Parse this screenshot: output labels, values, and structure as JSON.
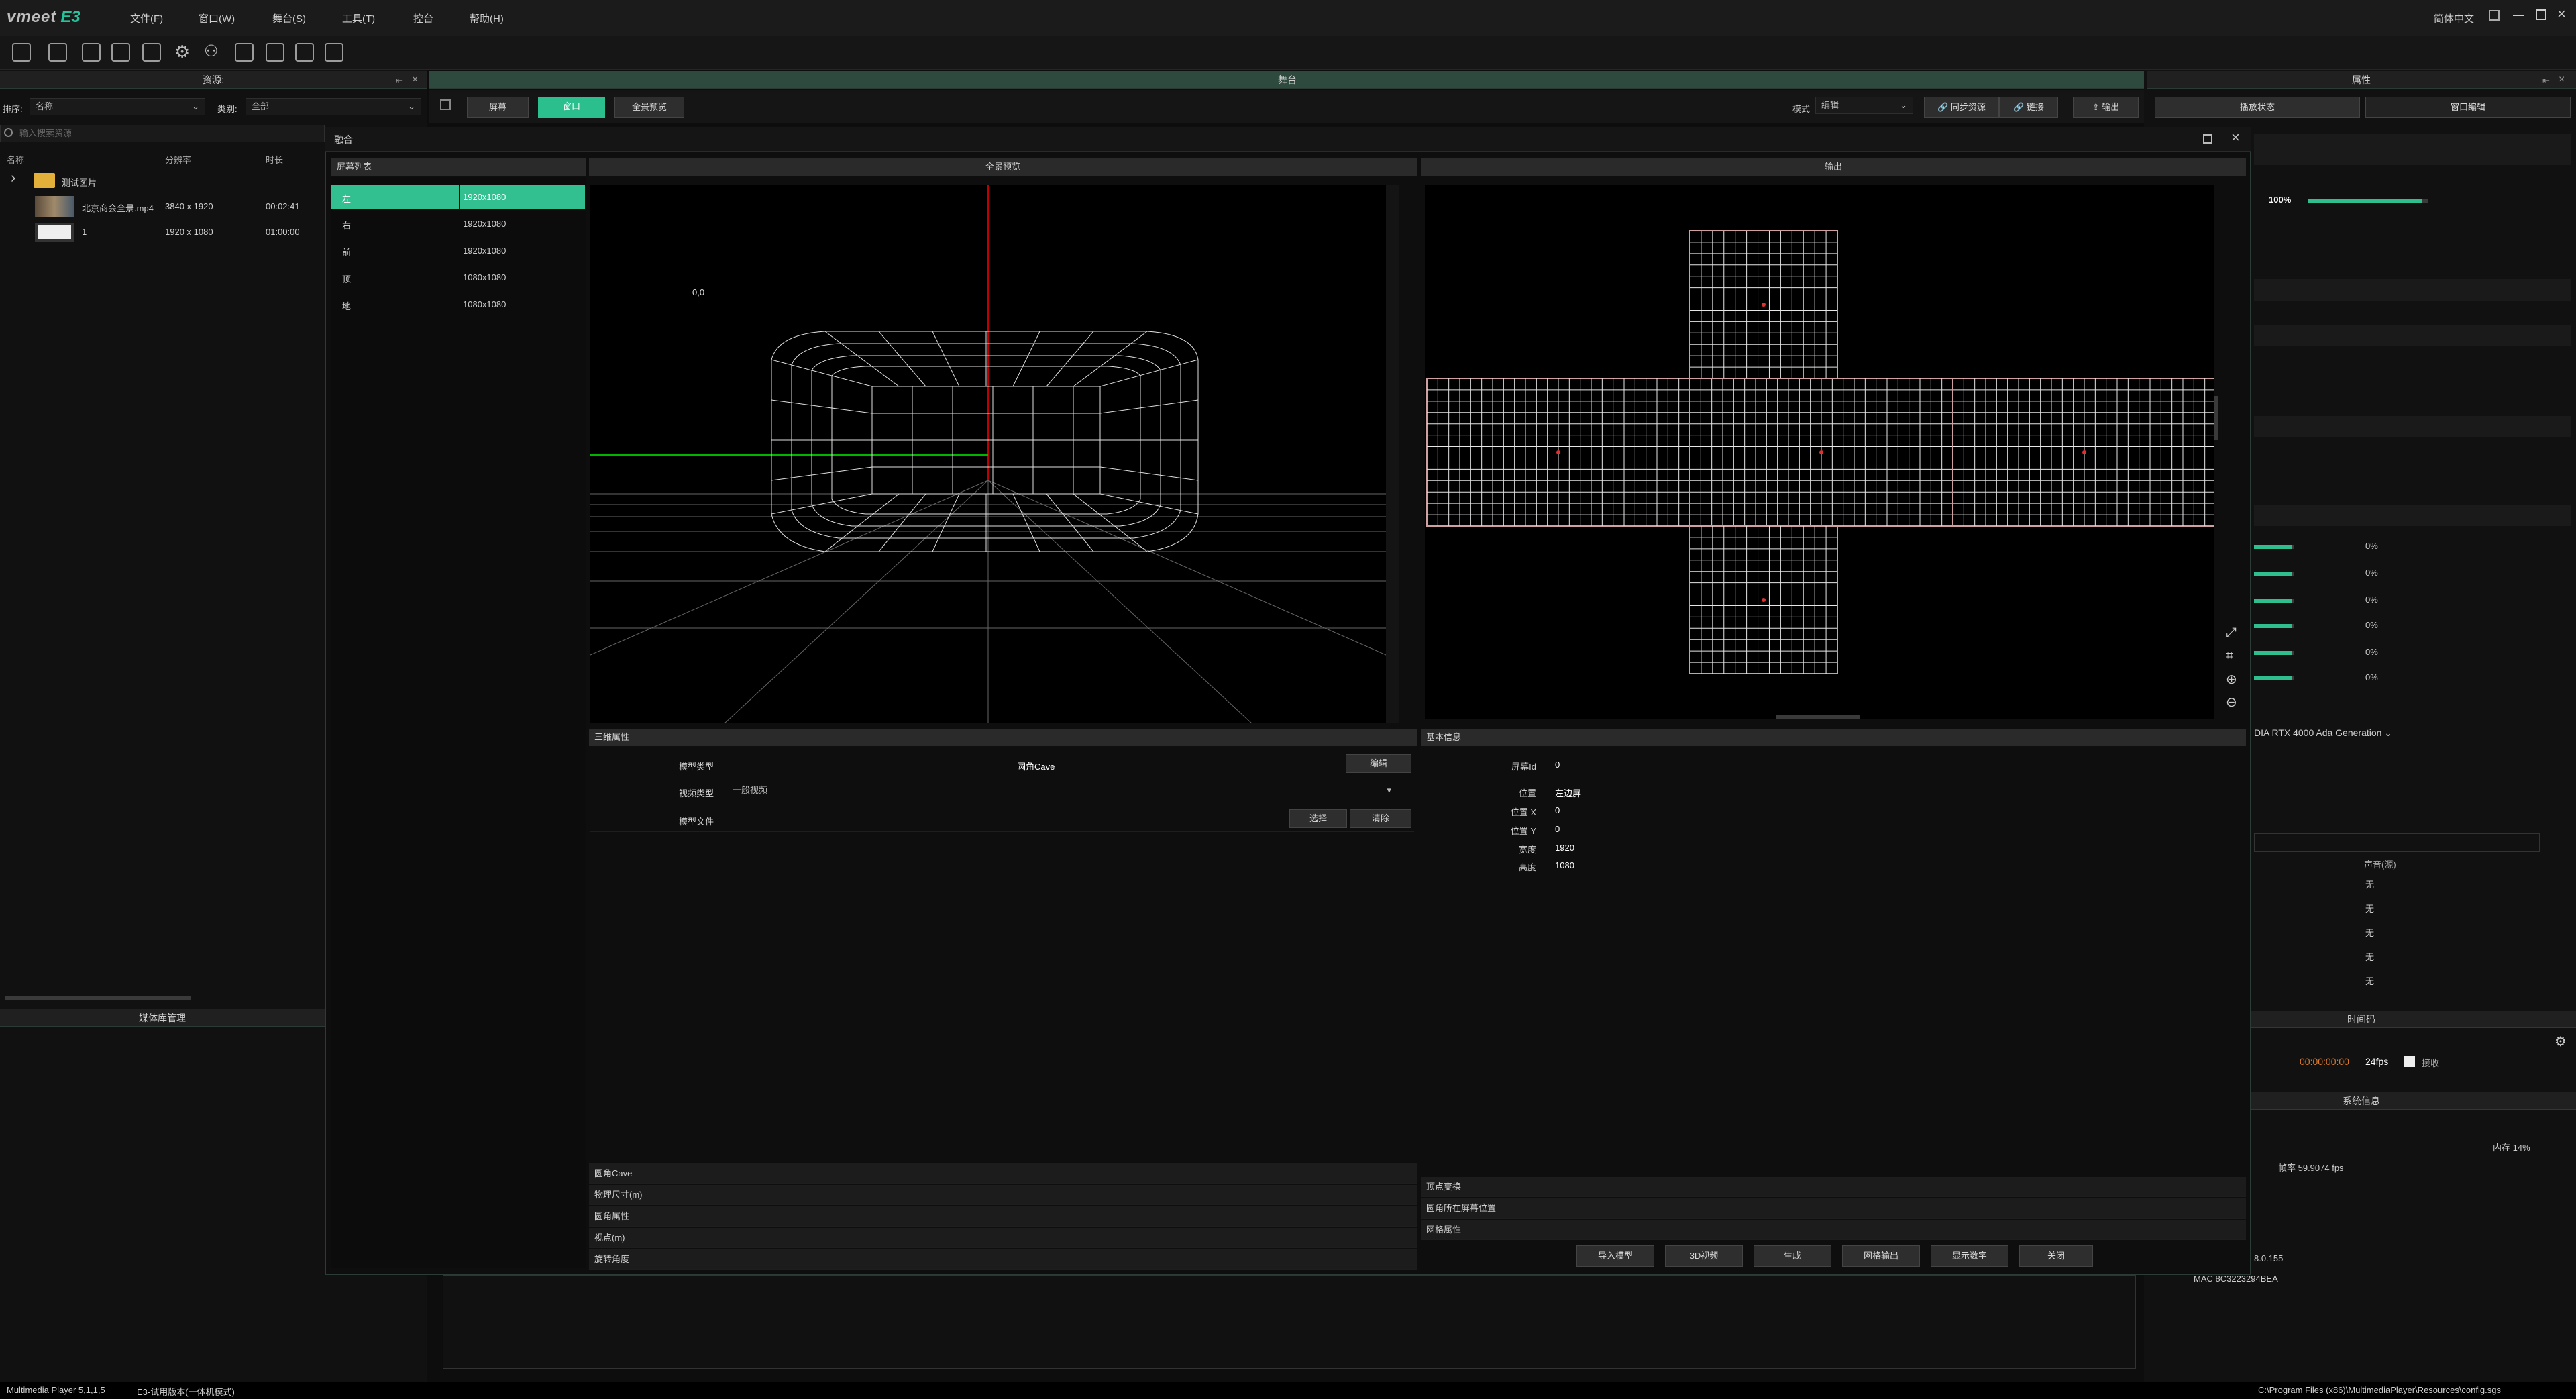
{
  "app": {
    "logo_text": "vmeet",
    "logo_accent": "E3",
    "menu": [
      "文件(F)",
      "窗口(W)",
      "舞台(S)",
      "工具(T)",
      "控台",
      "帮助(H)"
    ],
    "lang": "简体中文",
    "accent_color": "#2bbf8e"
  },
  "left_panel": {
    "title": "资源:",
    "sort_label": "排序:",
    "sort_value": "名称",
    "type_label": "类别:",
    "type_value": "全部",
    "search_placeholder": "输入搜索资源",
    "columns": [
      "名称",
      "分辨率",
      "时长"
    ],
    "folder": "测试图片",
    "files": [
      {
        "name": "北京商会全景.mp4",
        "res": "3840 x 1920",
        "dur": "00:02:41"
      },
      {
        "name": "1",
        "res": "1920 x 1080",
        "dur": "01:00:00"
      }
    ],
    "bottom_title": "媒体库管理"
  },
  "stage": {
    "title": "舞台",
    "tabs": [
      "屏幕",
      "窗口",
      "全景预览"
    ],
    "mode_label": "模式",
    "mode_value": "编辑",
    "buttons": [
      "同步资源",
      "链接",
      "输出"
    ]
  },
  "right_panel": {
    "title": "属性",
    "tabs": [
      "播放状态",
      "窗口编辑"
    ],
    "zoom": "100%",
    "zoom_level": 0.95,
    "percents": [
      "0%",
      "0%",
      "0%",
      "0%",
      "0%",
      "0%"
    ],
    "gpu": "DIA RTX 4000 Ada Generation",
    "audio_label": "声音(源)",
    "audio_values": [
      "无",
      "无",
      "无",
      "无",
      "无"
    ],
    "timecode_title": "时间码",
    "timecode": "00:00:00:00",
    "fps": "24fps",
    "loop": "接收",
    "sysinfo_title": "系统信息",
    "memory": "内存  14%",
    "framerate": "帧率  59.9074 fps",
    "ip": "8.0.155",
    "mac": "MAC  8C3223294BEA"
  },
  "dialog": {
    "title": "融合",
    "screen_list_title": "屏幕列表",
    "screens": [
      {
        "name": "左",
        "res": "1920x1080"
      },
      {
        "name": "右",
        "res": "1920x1080"
      },
      {
        "name": "前",
        "res": "1920x1080"
      },
      {
        "name": "顶",
        "res": "1080x1080"
      },
      {
        "name": "地",
        "res": "1080x1080"
      }
    ],
    "preview_title": "全景预览",
    "output_title": "输出",
    "coord_label": "0,0",
    "prop3d_title": "三维属性",
    "model_type_label": "模型类型",
    "model_type_value": "圆角Cave",
    "edit_btn": "编辑",
    "video_type_label": "视频类型",
    "video_type_value": "一般视频",
    "model_file_label": "模型文件",
    "select_btn": "选择",
    "clear_btn": "清除",
    "cave_sections": [
      "圆角Cave",
      "物理尺寸(m)",
      "圆角属性",
      "视点(m)",
      "旋转角度"
    ],
    "basic_title": "基本信息",
    "basic": [
      {
        "label": "屏幕Id",
        "value": "0"
      },
      {
        "label": "位置",
        "value": "左边屏"
      },
      {
        "label": "位置 X",
        "value": "0"
      },
      {
        "label": "位置 Y",
        "value": "0"
      },
      {
        "label": "宽度",
        "value": "1920"
      },
      {
        "label": "高度",
        "value": "1080"
      }
    ],
    "right_sections": [
      "顶点变换",
      "圆角所在屏幕位置",
      "网格属性"
    ],
    "footer_buttons": [
      "导入模型",
      "3D视频",
      "生成",
      "网格输出",
      "显示数字",
      "关闭"
    ]
  },
  "status": {
    "left": "Multimedia Player 5,1,1,5",
    "left2": "E3-试用版本(一体机模式)",
    "right": "C:\\Program Files (x86)\\MultimediaPlayer\\Resources\\config.sgs"
  }
}
